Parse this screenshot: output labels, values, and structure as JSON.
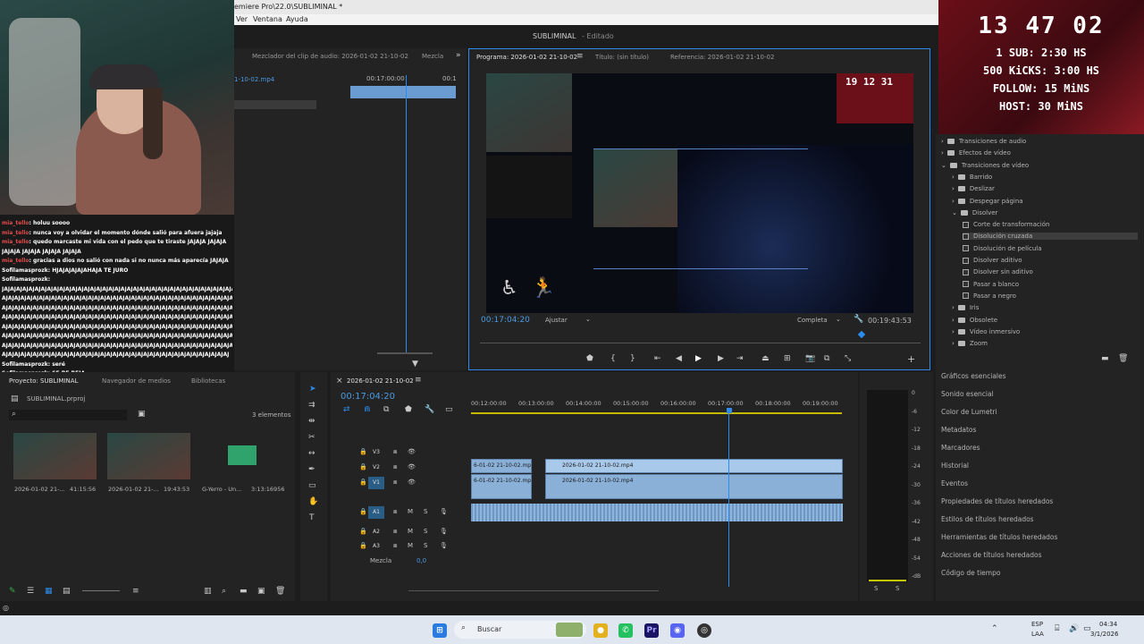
{
  "titlebar": {
    "title": "emiere Pro\\22.0\\SUBLIMINAL *"
  },
  "menubar": {
    "items": [
      "Ver",
      "Ventana",
      "Ayuda"
    ]
  },
  "workspace": {
    "project": "SUBLIMINAL",
    "status": "- Editado"
  },
  "overlay": {
    "time": "13 47 02",
    "lines": [
      "1 SUB: 2:30 HS",
      "500 KiCKS: 3:00 HS",
      "FOLLOW: 15 MiNS",
      "HOST: 30 MiNS"
    ]
  },
  "chat": [
    {
      "user": "mia_tello",
      "text": ": holuu soooo",
      "color_user": true
    },
    {
      "user": "mia_tello",
      "text": ": nunca voy a olvidar el momento dónde salió para afuera jajaja",
      "color_user": true
    },
    {
      "user": "mia_tello",
      "text": ": quedo marcaste mi vida con el pedo que te tiraste JAJAJA JAJAJA",
      "color_user": true
    },
    {
      "user": "",
      "text": "JAJAJA JAJAJA JAJAJA JAJAJA",
      "color_user": false
    },
    {
      "user": "mia_tello",
      "text": ": gracias a dios no salió con nada si no nunca más aparecía JAJAJA",
      "color_user": true
    },
    {
      "user": "Sofilamasprozk",
      "text": ": HJAJAJAJAJAHAJA TE JURO",
      "color_user": false
    },
    {
      "user": "Sofilamasprozk",
      "text": ":",
      "color_user": false
    },
    {
      "user": "",
      "text": "JAJAJAJAJAJAJAJAJAJAJAJAJAJAJAJAJAJAJAJAJAJAJAJAJAJAJAJAJAJAJAJAJAJAJAJAJAJAJAJAJAJ",
      "color_user": false
    },
    {
      "user": "",
      "text": "AJAJAJAJAJAJAJAJAJAJAJAJAJAJAJAJAJAJAJAJAJAJAJAJAJAJAJAJAJAJAJAJAJAJAJAJAJAJAJAJAJ",
      "color_user": false
    },
    {
      "user": "",
      "text": "AJAJAJAJAJAJAJAJAJAJAJAJAJAJAJAJAJAJAJAJAJAJAJAJAJAJAJAJAJAJAJAJAJAJAJAJAJAJAJAJAJ",
      "color_user": false
    },
    {
      "user": "",
      "text": "AJAJAJAJAJAJAJAJAJAJAJAJAJAJAJAJAJAJAJAJAJAJAJAJAJAJAJAJAJAJAJAJAJAJAJAJAJAJAJAJAJ",
      "color_user": false
    },
    {
      "user": "",
      "text": "AJAJAJAJAJAJAJAJAJAJAJAJAJAJAJAJAJAJAJAJAJAJAJAJAJAJAJAJAJAJAJAJAJAJAJAJAJAJAJAJAJ",
      "color_user": false
    },
    {
      "user": "",
      "text": "AJAJAJAJAJAJAJAJAJAJAJAJAJAJAJAJAJAJAJAJAJAJAJAJAJAJAJAJAJAJAJAJAJAJAJAJAJAJAJAJAJ",
      "color_user": false
    },
    {
      "user": "",
      "text": "AJAJAJAJAJAJAJAJAJAJAJAJAJAJAJAJAJAJAJAJAJAJAJAJAJAJAJAJAJAJAJAJAJAJAJAJAJAJAJAJAJ",
      "color_user": false
    },
    {
      "user": "",
      "text": "AJAJAJAJAJAJAJAJAJAJAJAJAJAJAJAJAJAJAJAJAJAJAJAJAJAJAJAJAJAJAJAJAJAJAJAJAJ",
      "color_user": false
    },
    {
      "user": "Sofilamasprozk",
      "text": ": seré",
      "color_user": false
    },
    {
      "user": "Sofilamasprozk",
      "text": ": SE RE REIA",
      "color_user": false
    }
  ],
  "source_panel": {
    "tab_mixer": "Mezclador del clip de audio: 2026-01-02 21-10-02",
    "tab_mezcla": "Mezcla",
    "clip_name": "1-10-02.mp4",
    "timecode": "00:17:00:00",
    "timecode2": "00:1"
  },
  "program": {
    "tab_program": "Programa: 2026-01-02 21-10-02",
    "tab_title": "Título: (sin título)",
    "tab_reference": "Referencia: 2026-01-02 21-10-02",
    "current_time": "00:17:04:20",
    "fit": "Ajustar",
    "quality": "Completa",
    "duration": "00:19:43:53",
    "overlay_time": "19 12 31"
  },
  "project": {
    "tabs": [
      "Proyecto: SUBLIMINAL",
      "Navegador de medios",
      "Bibliotecas"
    ],
    "file": "SUBLIMINAL.prproj",
    "count": "3 elementos",
    "items": [
      {
        "name": "2026-01-02 21-...",
        "duration": "41:15:56"
      },
      {
        "name": "2026-01-02 21-...",
        "duration": "19:43:53"
      },
      {
        "name": "G-Yerro - Un...",
        "duration": "3:13:16956"
      }
    ]
  },
  "timeline": {
    "tab": "2026-01-02 21-10-02",
    "timecode": "00:17:04:20",
    "ruler": [
      "00:12:00:00",
      "00:13:00:00",
      "00:14:00:00",
      "00:15:00:00",
      "00:16:00:00",
      "00:17:00:00",
      "00:18:00:00",
      "00:19:00:00"
    ],
    "tracks": [
      "V3",
      "V2",
      "V1",
      "A1",
      "A2",
      "A3"
    ],
    "mix_label": "Mezcla",
    "mix_value": "0,0",
    "clips": {
      "v2_a": "6-01-02 21-10-02.mp4",
      "v2_b": "2026-01-02 21-10-02.mp4",
      "v1_a": "6-01-02 21-10-02.mp4",
      "v1_b": "2026-01-02 21-10-02.mp4"
    },
    "meter_scale": [
      "0",
      "-6",
      "-12",
      "-18",
      "-24",
      "-30",
      "-36",
      "-42",
      "-48",
      "-54",
      "-dB"
    ],
    "meter_solo": [
      "S",
      "S"
    ]
  },
  "effects": {
    "tree": [
      {
        "label": "Transiciones de audio",
        "level": 0,
        "type": "folder"
      },
      {
        "label": "Efectos de vídeo",
        "level": 0,
        "type": "folder"
      },
      {
        "label": "Transiciones de vídeo",
        "level": 0,
        "type": "folder-open"
      },
      {
        "label": "Barrido",
        "level": 1,
        "type": "folder"
      },
      {
        "label": "Deslizar",
        "level": 1,
        "type": "folder"
      },
      {
        "label": "Despegar página",
        "level": 1,
        "type": "folder"
      },
      {
        "label": "Disolver",
        "level": 1,
        "type": "folder-open"
      },
      {
        "label": "Corte de transformación",
        "level": 2,
        "type": "item"
      },
      {
        "label": "Disolución cruzada",
        "level": 2,
        "type": "item-selected"
      },
      {
        "label": "Disolución de película",
        "level": 2,
        "type": "item"
      },
      {
        "label": "Disolver aditivo",
        "level": 2,
        "type": "item"
      },
      {
        "label": "Disolver sin aditivo",
        "level": 2,
        "type": "item"
      },
      {
        "label": "Pasar a blanco",
        "level": 2,
        "type": "item"
      },
      {
        "label": "Pasar a negro",
        "level": 2,
        "type": "item"
      },
      {
        "label": "Iris",
        "level": 1,
        "type": "folder"
      },
      {
        "label": "Obsolete",
        "level": 1,
        "type": "folder"
      },
      {
        "label": "Vídeo inmersivo",
        "level": 1,
        "type": "folder"
      },
      {
        "label": "Zoom",
        "level": 1,
        "type": "folder"
      }
    ],
    "panels": [
      "Gráficos esenciales",
      "Sonido esencial",
      "Color de Lumetri",
      "Metadatos",
      "Marcadores",
      "Historial",
      "Eventos",
      "Propiedades de títulos heredados",
      "Estilos de títulos heredados",
      "Herramientas de títulos heredados",
      "Acciones de títulos heredados",
      "Código de tiempo"
    ]
  },
  "taskbar": {
    "search": "Buscar",
    "lang": "ESP",
    "lang2": "LAA",
    "time": "04:34",
    "date": "3/1/2026"
  },
  "colors": {
    "accent": "#2d8ceb",
    "clip": "#8ab0d8",
    "overlay": "#6b0f18"
  }
}
